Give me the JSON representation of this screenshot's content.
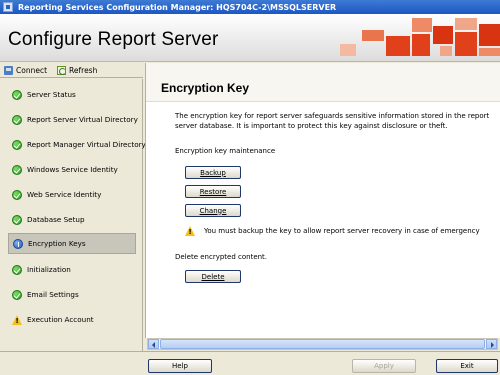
{
  "window": {
    "title": "Reporting Services Configuration Manager: HQS704C-2\\MSSQLSERVER"
  },
  "banner": {
    "title": "Configure Report Server"
  },
  "toolbar": {
    "connect_label": "Connect",
    "refresh_label": "Refresh"
  },
  "nav": {
    "items": [
      {
        "label": "Server Status",
        "status": "ok",
        "selected": false
      },
      {
        "label": "Report Server Virtual Directory",
        "status": "ok",
        "selected": false
      },
      {
        "label": "Report Manager Virtual Directory",
        "status": "ok",
        "selected": false
      },
      {
        "label": "Windows Service Identity",
        "status": "ok",
        "selected": false
      },
      {
        "label": "Web Service Identity",
        "status": "ok",
        "selected": false
      },
      {
        "label": "Database Setup",
        "status": "ok",
        "selected": false
      },
      {
        "label": "Encryption Keys",
        "status": "info",
        "selected": true
      },
      {
        "label": "Initialization",
        "status": "ok",
        "selected": false
      },
      {
        "label": "Email Settings",
        "status": "ok",
        "selected": false
      },
      {
        "label": "Execution Account",
        "status": "warning",
        "selected": false
      }
    ]
  },
  "main": {
    "title": "Encryption Key",
    "description": "The encryption key for report server safeguards sensitive information stored in the report server database. It is important to protect this key against disclosure or theft.",
    "maintenance_label": "Encryption key maintenance",
    "backup_label": "Backup",
    "restore_label": "Restore",
    "change_label": "Change",
    "warning_text": "You must backup the key to allow report server recovery in case of emergency",
    "delete_section_label": "Delete encrypted content.",
    "delete_label": "Delete"
  },
  "footer": {
    "help_label": "Help",
    "apply_label": "Apply",
    "exit_label": "Exit"
  },
  "colors": {
    "title_bar": "#1d56c4",
    "banner_accent": "#e0401a",
    "ok_status": "#2c9a1f",
    "warning_status": "#f2c21b"
  }
}
